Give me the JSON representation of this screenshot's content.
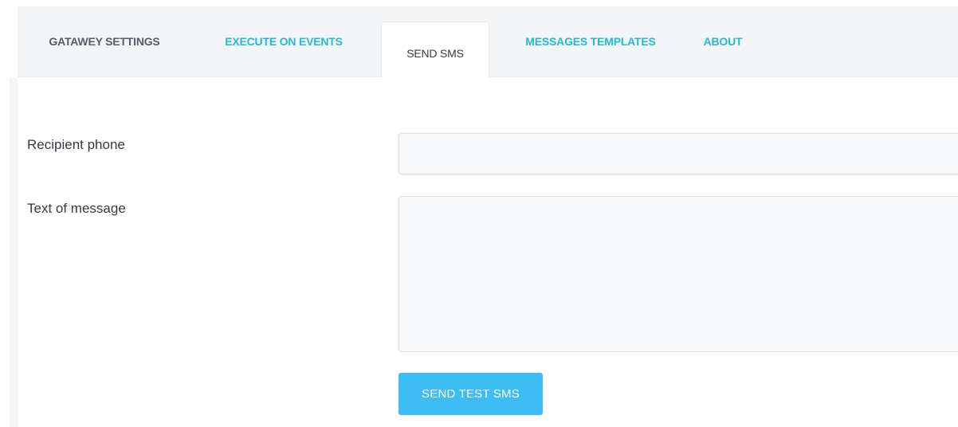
{
  "tabs": [
    {
      "label": "GATAWEY SETTINGS",
      "state": "inactive"
    },
    {
      "label": "EXECUTE ON EVENTS",
      "state": "link"
    },
    {
      "label": "SEND SMS",
      "state": "active"
    },
    {
      "label": "MESSAGES TEMPLATES",
      "state": "link"
    },
    {
      "label": "ABOUT",
      "state": "link"
    }
  ],
  "form": {
    "recipient_label": "Recipient phone",
    "recipient_value": "",
    "message_label": "Text of message",
    "message_value": "",
    "send_button_label": "SEND TEST SMS"
  },
  "colors": {
    "accent": "#25b9d7",
    "button": "#3ebcf4",
    "text": "#363a41",
    "tab_bar_bg": "#f3f5f7"
  }
}
